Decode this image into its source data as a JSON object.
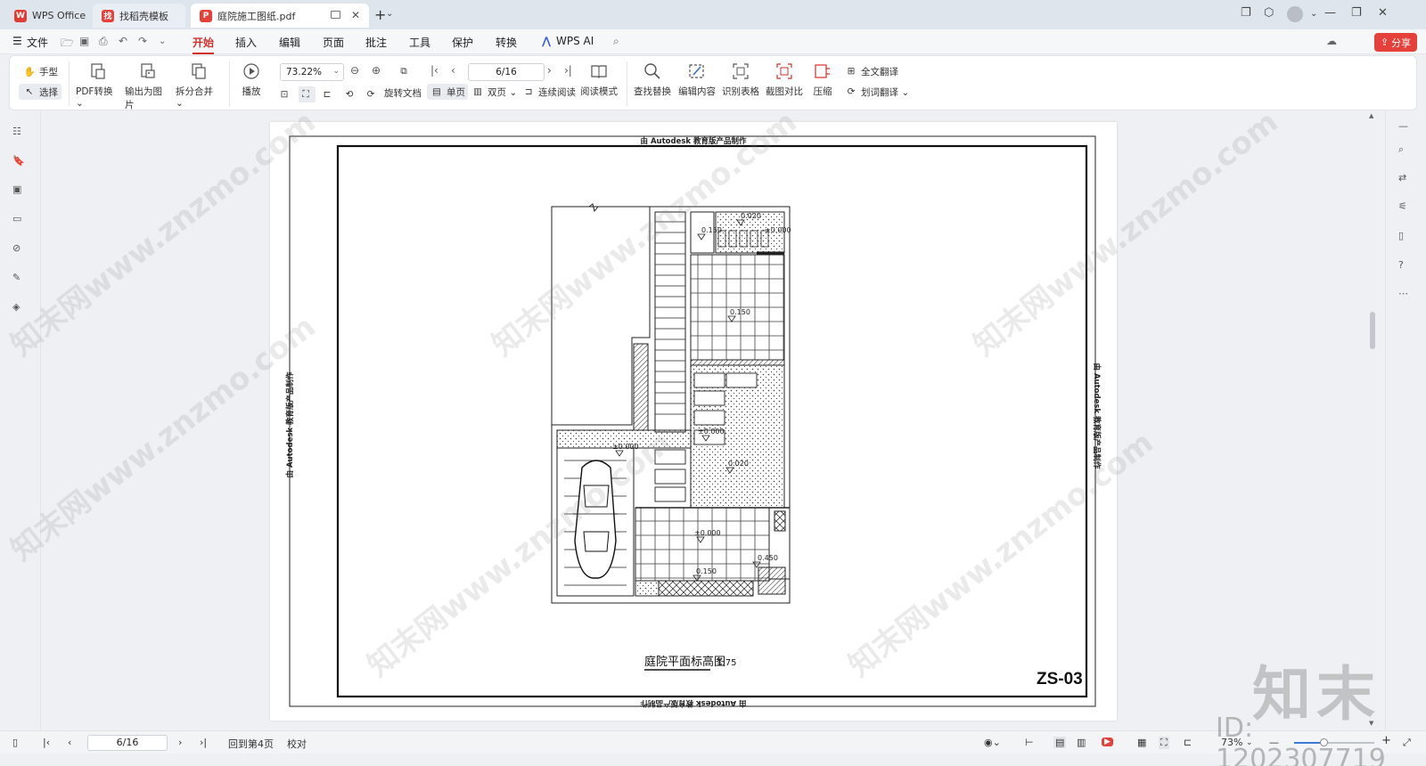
{
  "tabs": [
    {
      "label": "WPS Office"
    },
    {
      "label": "找稻壳模板"
    },
    {
      "label": "庭院施工图纸.pdf"
    }
  ],
  "menu": {
    "file": "文件",
    "items": [
      "开始",
      "插入",
      "编辑",
      "页面",
      "批注",
      "工具",
      "保护",
      "转换"
    ],
    "wps_ai": "WPS AI",
    "share": "分享"
  },
  "toolbar": {
    "hand": "手型",
    "select": "选择",
    "pdf_convert": "PDF转换",
    "export_image": "输出为图片",
    "split_merge": "拆分合并",
    "play": "播放",
    "zoom": "73.22%",
    "rotate_doc": "旋转文档",
    "single_page": "单页",
    "double_page": "双页",
    "continuous": "连续阅读",
    "read_mode": "阅读模式",
    "page": "6/16",
    "find_replace": "查找替换",
    "edit_content": "编辑内容",
    "recognize_table": "识别表格",
    "screenshot_compare": "截图对比",
    "compress": "压缩",
    "full_translate": "全文翻译",
    "word_translate": "划词翻译"
  },
  "drawing": {
    "autodesk_text": "由 Autodesk 教育版产品制作",
    "title": "庭院平面标高图",
    "scale": "1:75",
    "sheet_no": "ZS-03",
    "levels": [
      "0.020",
      "0.150",
      "±0.000",
      "0.150",
      "±0.000",
      "0.020",
      "±0.000",
      "0.450",
      "0.150"
    ]
  },
  "statusbar": {
    "page": "6/16",
    "back_to": "回到第4页",
    "proofread": "校对",
    "zoom": "73%"
  },
  "watermark": {
    "site": "知末网www.znzmo.com",
    "logo": "知末",
    "id": "ID: 1202307719"
  },
  "colors": {
    "accent": "#d4302b",
    "share_bg": "#e5413a"
  }
}
